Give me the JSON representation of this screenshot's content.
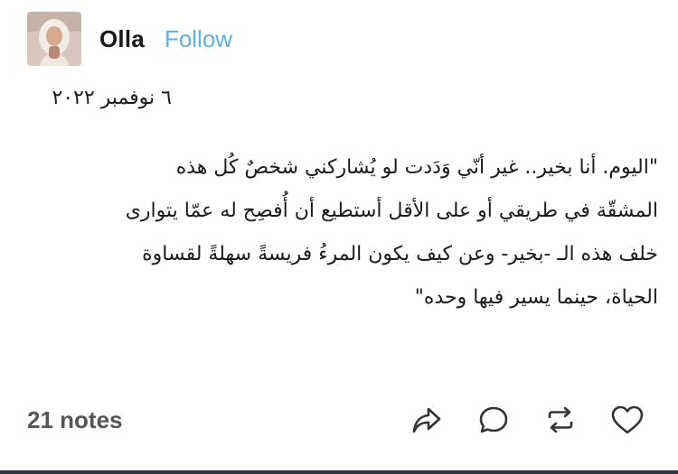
{
  "post": {
    "author": "Olla",
    "follow_label": "Follow",
    "date": "٦ نوفمبر ٢٠٢٢",
    "body_lines": [
      "\"اليوم. أنا بخير.. غير أنّي وَدَدت لو يُشاركني شخصٌ كُل هذه",
      "المشقّة في طريقي أو على الأقل أستطيع أن أُفصِح له عمّا يتوارى",
      "خلف هذه الـ -بخير- وعن كيف يكون المرءُ فريسةً سهلةً لقساوة",
      "الحياة، حينما يسير فيها وحده\""
    ]
  },
  "footer": {
    "notes_label": "21 notes",
    "actions": {
      "share": "share-icon",
      "reply": "reply-icon",
      "reblog": "reblog-icon",
      "like": "heart-icon"
    }
  },
  "colors": {
    "follow": "#5fb0e8",
    "text": "#1a1a1a",
    "notes": "#555555",
    "bottom_rule": "#2f3545"
  }
}
